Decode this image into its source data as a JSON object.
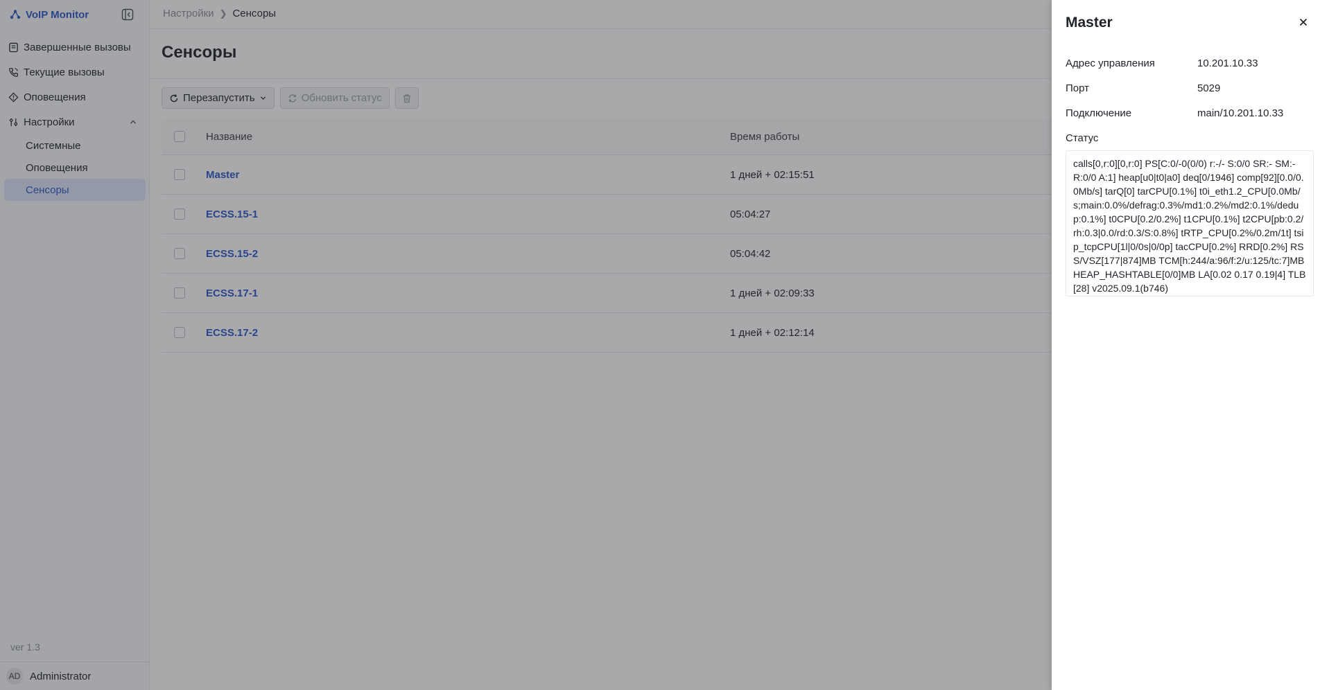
{
  "app": {
    "name": "VoIP Monitor"
  },
  "sidebar": {
    "items": [
      {
        "label": "Завершенные вызовы"
      },
      {
        "label": "Текущие вызовы"
      },
      {
        "label": "Оповещения"
      },
      {
        "label": "Настройки"
      }
    ],
    "settings_sub": [
      {
        "label": "Системные"
      },
      {
        "label": "Оповещения"
      },
      {
        "label": "Сенсоры"
      }
    ],
    "version": "ver 1.3",
    "user": {
      "initials": "AD",
      "name": "Administrator"
    }
  },
  "breadcrumb": {
    "parent": "Настройки",
    "current": "Сенсоры"
  },
  "page": {
    "title": "Сенсоры"
  },
  "toolbar": {
    "restart_label": "Перезапустить",
    "refresh_label": "Обновить статус"
  },
  "table": {
    "columns": {
      "name": "Название",
      "uptime": "Время работы"
    },
    "rows": [
      {
        "name": "Master",
        "uptime": "1 дней + 02:15:51"
      },
      {
        "name": "ECSS.15-1",
        "uptime": "05:04:27"
      },
      {
        "name": "ECSS.15-2",
        "uptime": "05:04:42"
      },
      {
        "name": "ECSS.17-1",
        "uptime": "1 дней + 02:09:33"
      },
      {
        "name": "ECSS.17-2",
        "uptime": "1 дней + 02:12:14"
      }
    ]
  },
  "drawer": {
    "title": "Master",
    "fields": {
      "address_label": "Адрес управления",
      "address_value": "10.201.10.33",
      "port_label": "Порт",
      "port_value": "5029",
      "connection_label": "Подключение",
      "connection_value": "main/10.201.10.33",
      "status_label": "Статус"
    },
    "status_text": "calls[0,r:0][0,r:0] PS[C:0/-0(0/0) r:-/- S:0/0 SR:- SM:- R:0/0 A:1] heap[u0|t0|a0] deq[0/1946] comp[92][0.0/0.0Mb/s] tarQ[0] tarCPU[0.1%] t0i_eth1.2_CPU[0.0Mb/s;main:0.0%/defrag:0.3%/md1:0.2%/md2:0.1%/dedup:0.1%] t0CPU[0.2/0.2%] t1CPU[0.1%] t2CPU[pb:0.2/rh:0.3|0.0/rd:0.3/S:0.8%] tRTP_CPU[0.2%/0.2m/1t] tsip_tcpCPU[1l|0/0s|0/0p] tacCPU[0.2%] RRD[0.2%] RSS/VSZ[177|874]MB TCM[h:244/a:96/f:2/u:125/tc:7]MB HEAP_HASHTABLE[0/0]MB LA[0.02 0.17 0.19|4] TLB[28] v2025.09.1(b746)"
  },
  "colors": {
    "accent": "#2b58c9",
    "active_bg": "#dbe4f7"
  }
}
